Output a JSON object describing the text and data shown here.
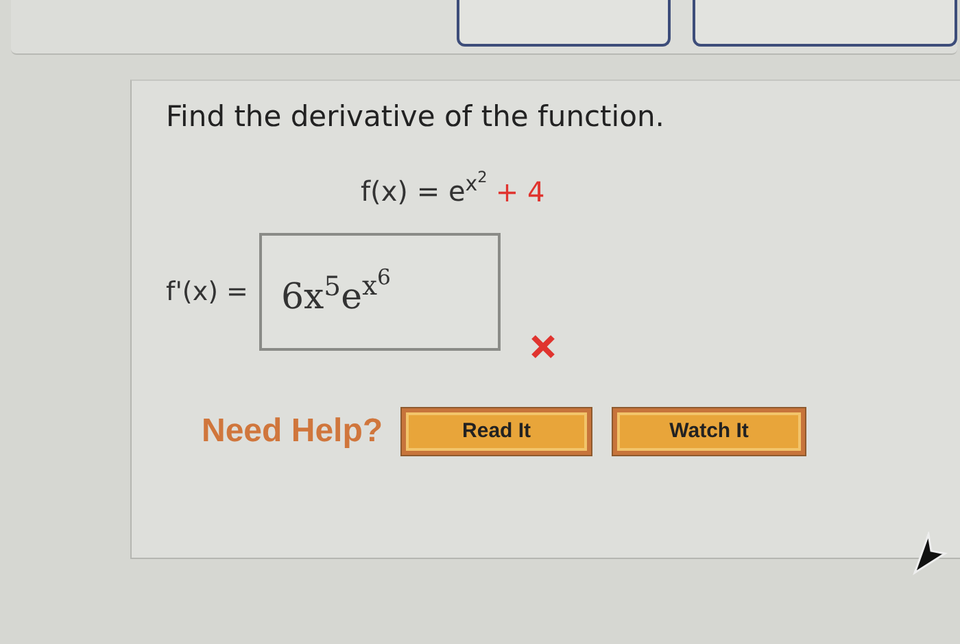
{
  "question": {
    "prompt": "Find the derivative of the function.",
    "function": {
      "lhs": "f(x) =",
      "base": "e",
      "exponent": "x",
      "exponent_power": "2",
      "constant": "+ 4"
    },
    "answer": {
      "label": "f'(x) =",
      "coefficient": "6x",
      "power": "5",
      "base": "e",
      "exponent": "x",
      "exponent_power": "6",
      "correct": false
    }
  },
  "help": {
    "label": "Need Help?",
    "buttons": [
      "Read It",
      "Watch It"
    ]
  }
}
